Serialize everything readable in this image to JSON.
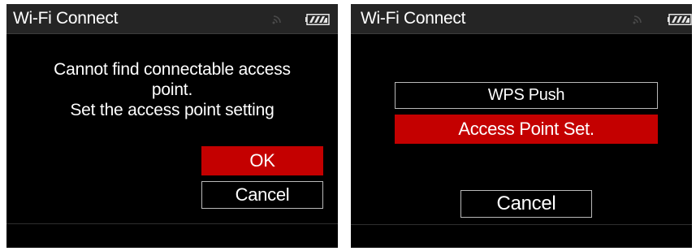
{
  "colors": {
    "screen_background": "#000000",
    "title_bar": "#252525",
    "selected_button": "#c40000",
    "button_border": "#b9b9b9",
    "text": "#ffffff"
  },
  "left_screen": {
    "title": "Wi-Fi Connect",
    "status_icons": [
      "wifi-signal-icon",
      "battery-icon"
    ],
    "message_lines": [
      "Cannot find connectable access",
      "point.",
      "Set the access point setting"
    ],
    "buttons": {
      "ok_label": "OK",
      "cancel_label": "Cancel"
    },
    "selected_button": "OK"
  },
  "right_screen": {
    "title": "Wi-Fi Connect",
    "status_icons": [
      "wifi-signal-icon",
      "battery-icon"
    ],
    "menu_items": [
      {
        "label": "WPS Push"
      },
      {
        "label": "Access Point Set."
      }
    ],
    "cancel_label": "Cancel",
    "selected_item": "Access Point Set."
  }
}
